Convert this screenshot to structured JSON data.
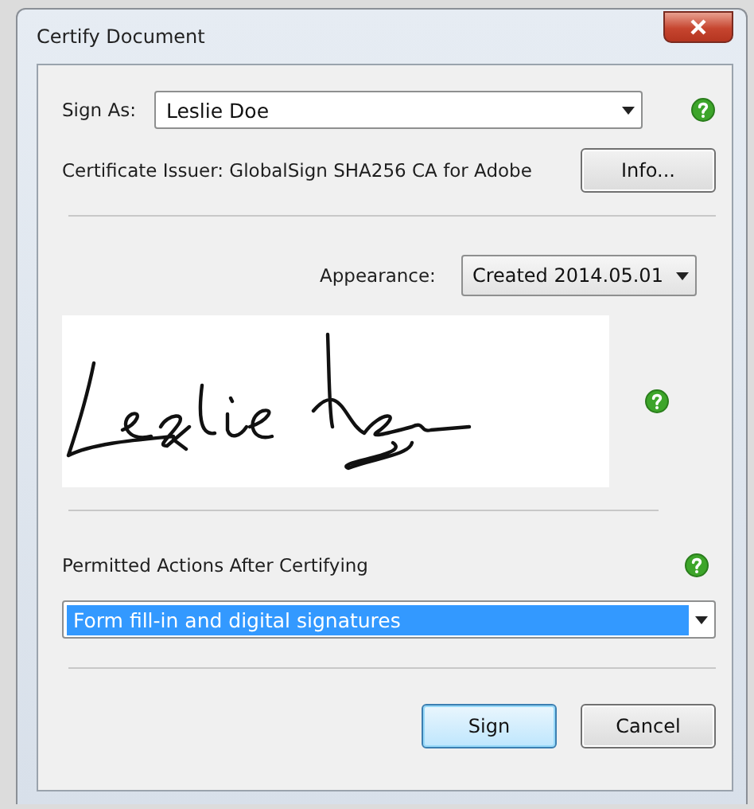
{
  "window": {
    "title": "Certify Document"
  },
  "sign_as": {
    "label": "Sign As:",
    "value": "Leslie Doe"
  },
  "certificate_issuer": {
    "text": "Certificate Issuer: GlobalSign SHA256 CA for Adobe",
    "button": "Info..."
  },
  "appearance": {
    "label": "Appearance:",
    "value": "Created 2014.05.01"
  },
  "permitted_actions": {
    "label": "Permitted Actions After Certifying",
    "value": "Form fill-in and digital signatures",
    "selected": true
  },
  "buttons": [
    {
      "label": "Sign",
      "default": true
    },
    {
      "label": "Cancel",
      "default": false
    }
  ]
}
